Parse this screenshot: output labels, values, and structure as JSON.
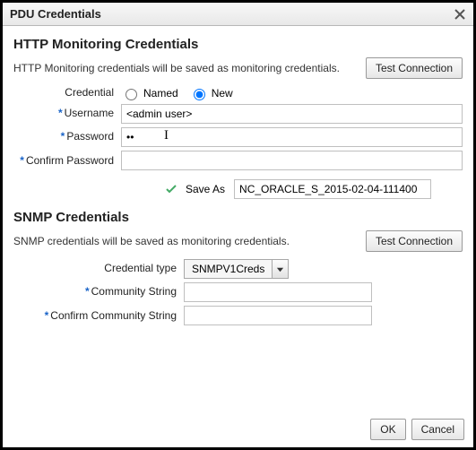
{
  "dialog": {
    "title": "PDU Credentials",
    "close_icon": "close-icon"
  },
  "http": {
    "heading": "HTTP Monitoring Credentials",
    "subtext": "HTTP Monitoring credentials will be saved as monitoring credentials.",
    "test_btn": "Test Connection",
    "credential_label": "Credential",
    "named_label": "Named",
    "new_label": "New",
    "credential_selected": "new",
    "username_label": "Username",
    "username_value": "<admin user>",
    "password_label": "Password",
    "password_value": "••",
    "confirm_label": "Confirm Password",
    "confirm_value": "",
    "saveas_label": "Save As",
    "saveas_value": "NC_ORACLE_S_2015-02-04-111400"
  },
  "snmp": {
    "heading": "SNMP Credentials",
    "subtext": "SNMP credentials will be saved as monitoring credentials.",
    "test_btn": "Test Connection",
    "type_label": "Credential type",
    "type_value": "SNMPV1Creds",
    "community_label": "Community String",
    "community_value": "",
    "confirm_label": "Confirm Community String",
    "confirm_value": ""
  },
  "footer": {
    "ok": "OK",
    "cancel": "Cancel"
  }
}
